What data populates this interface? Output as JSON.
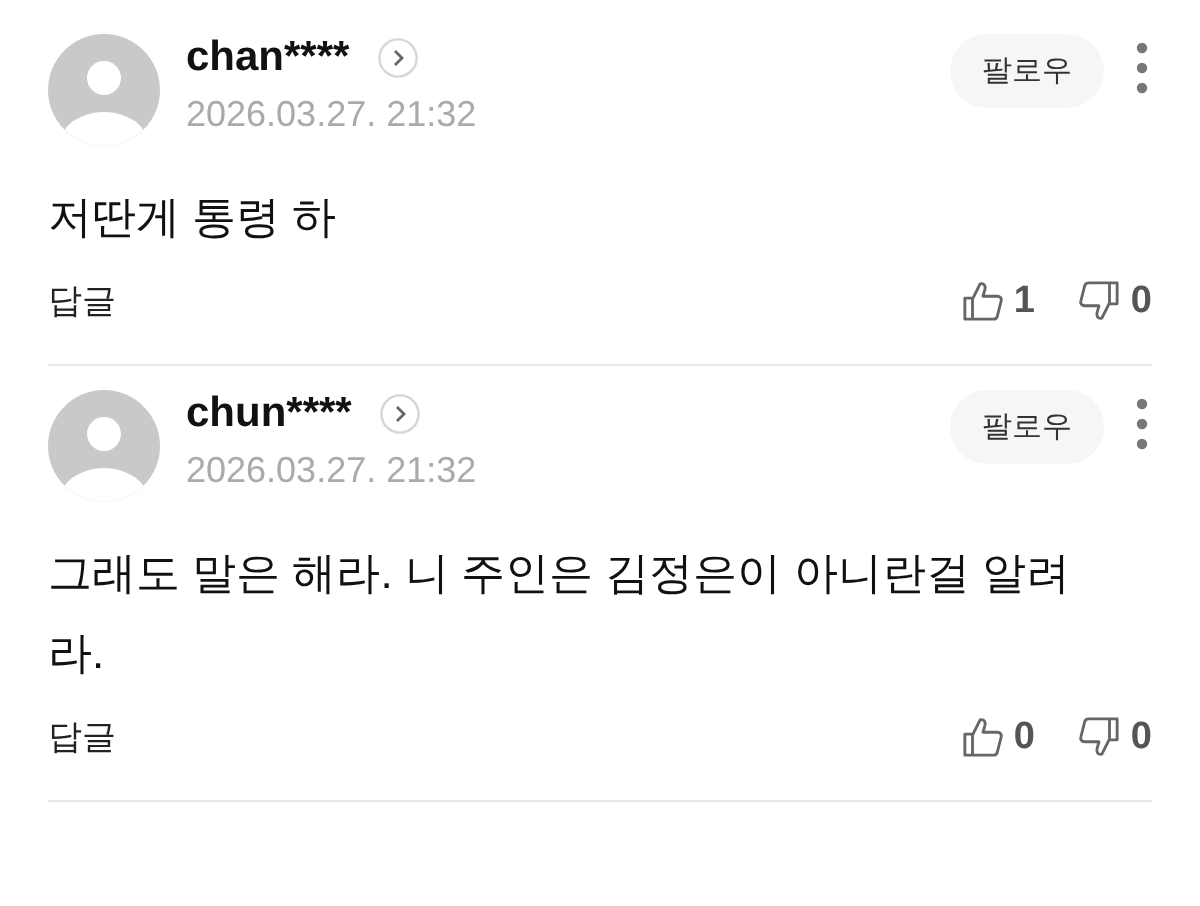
{
  "comments": [
    {
      "username": "chan****",
      "date": "2026.03.27. 21:32",
      "follow": "팔로우",
      "body": "저딴게 통령 하",
      "reply": "답글",
      "likes": "1",
      "dislikes": "0"
    },
    {
      "username": "chun****",
      "date": "2026.03.27. 21:32",
      "follow": "팔로우",
      "body": "그래도 말은 해라. 니 주인은 김정은이 아니란걸 알려라.",
      "reply": "답글",
      "likes": "0",
      "dislikes": "0"
    }
  ]
}
